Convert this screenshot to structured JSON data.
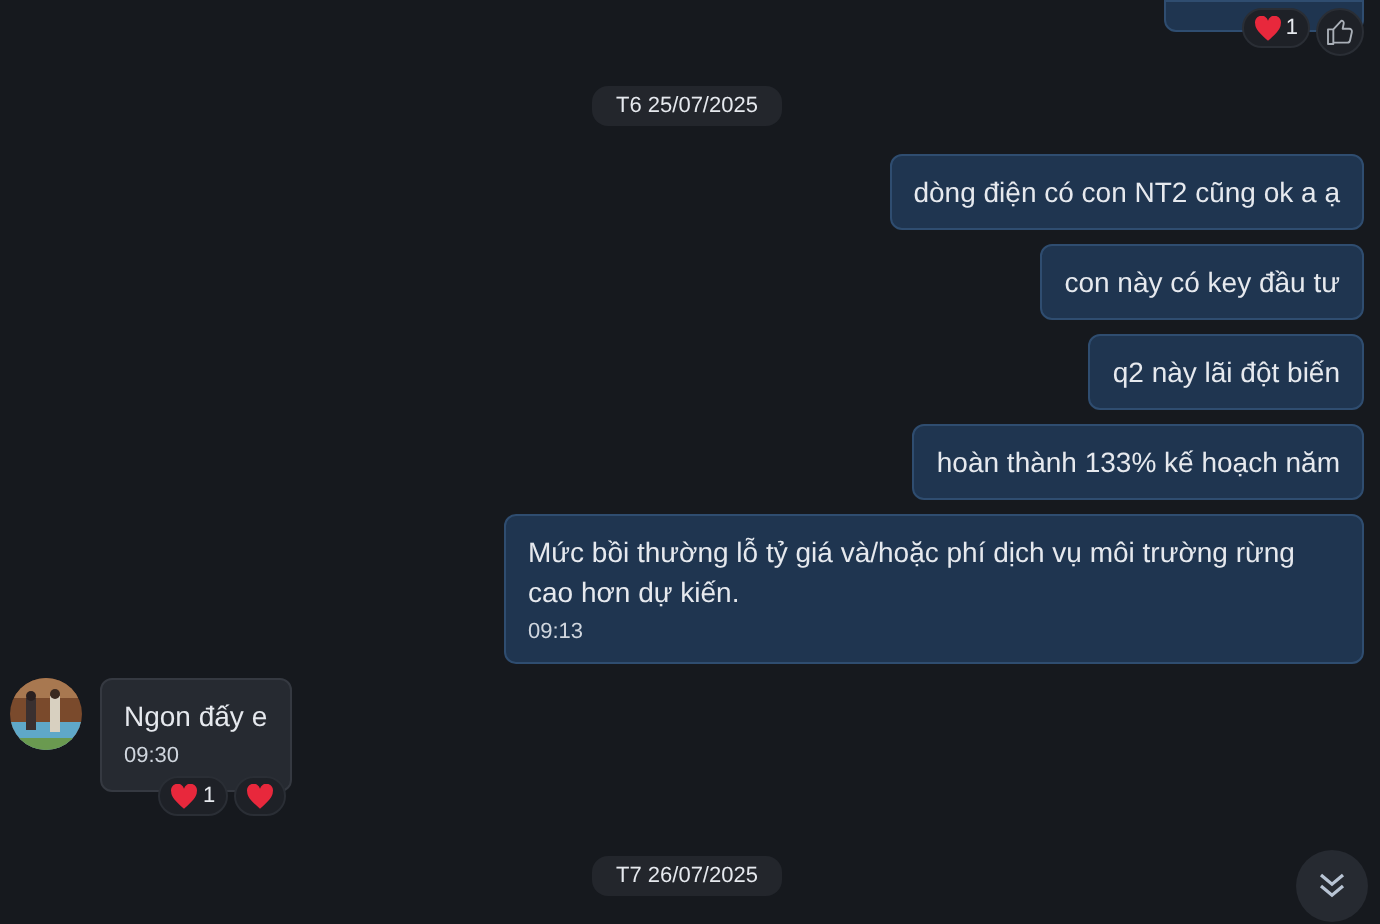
{
  "items": [
    {
      "kind": "stub",
      "outgoing": true,
      "reactions": [
        {
          "kind": "heart",
          "count": "1"
        },
        {
          "kind": "like"
        }
      ]
    },
    {
      "kind": "date",
      "text": "T6 25/07/2025"
    },
    {
      "kind": "message",
      "outgoing": true,
      "text": "dòng điện có con NT2 cũng ok a ạ"
    },
    {
      "kind": "message",
      "outgoing": true,
      "text": "con này có key đầu tư"
    },
    {
      "kind": "message",
      "outgoing": true,
      "text": "q2 này lãi đột biến"
    },
    {
      "kind": "message",
      "outgoing": true,
      "text": "hoàn thành 133% kế hoạch năm"
    },
    {
      "kind": "message",
      "outgoing": true,
      "text": "Mức bồi thường lỗ tỷ giá và/hoặc phí dịch vụ môi trường rừng cao hơn dự kiến.",
      "time": "09:13"
    },
    {
      "kind": "message",
      "outgoing": false,
      "avatar": true,
      "text": "Ngon đấy e",
      "time": "09:30",
      "reactions": [
        {
          "kind": "heart",
          "count": "1"
        },
        {
          "kind": "heart"
        }
      ]
    },
    {
      "kind": "date",
      "text": "T7 26/07/2025"
    }
  ]
}
